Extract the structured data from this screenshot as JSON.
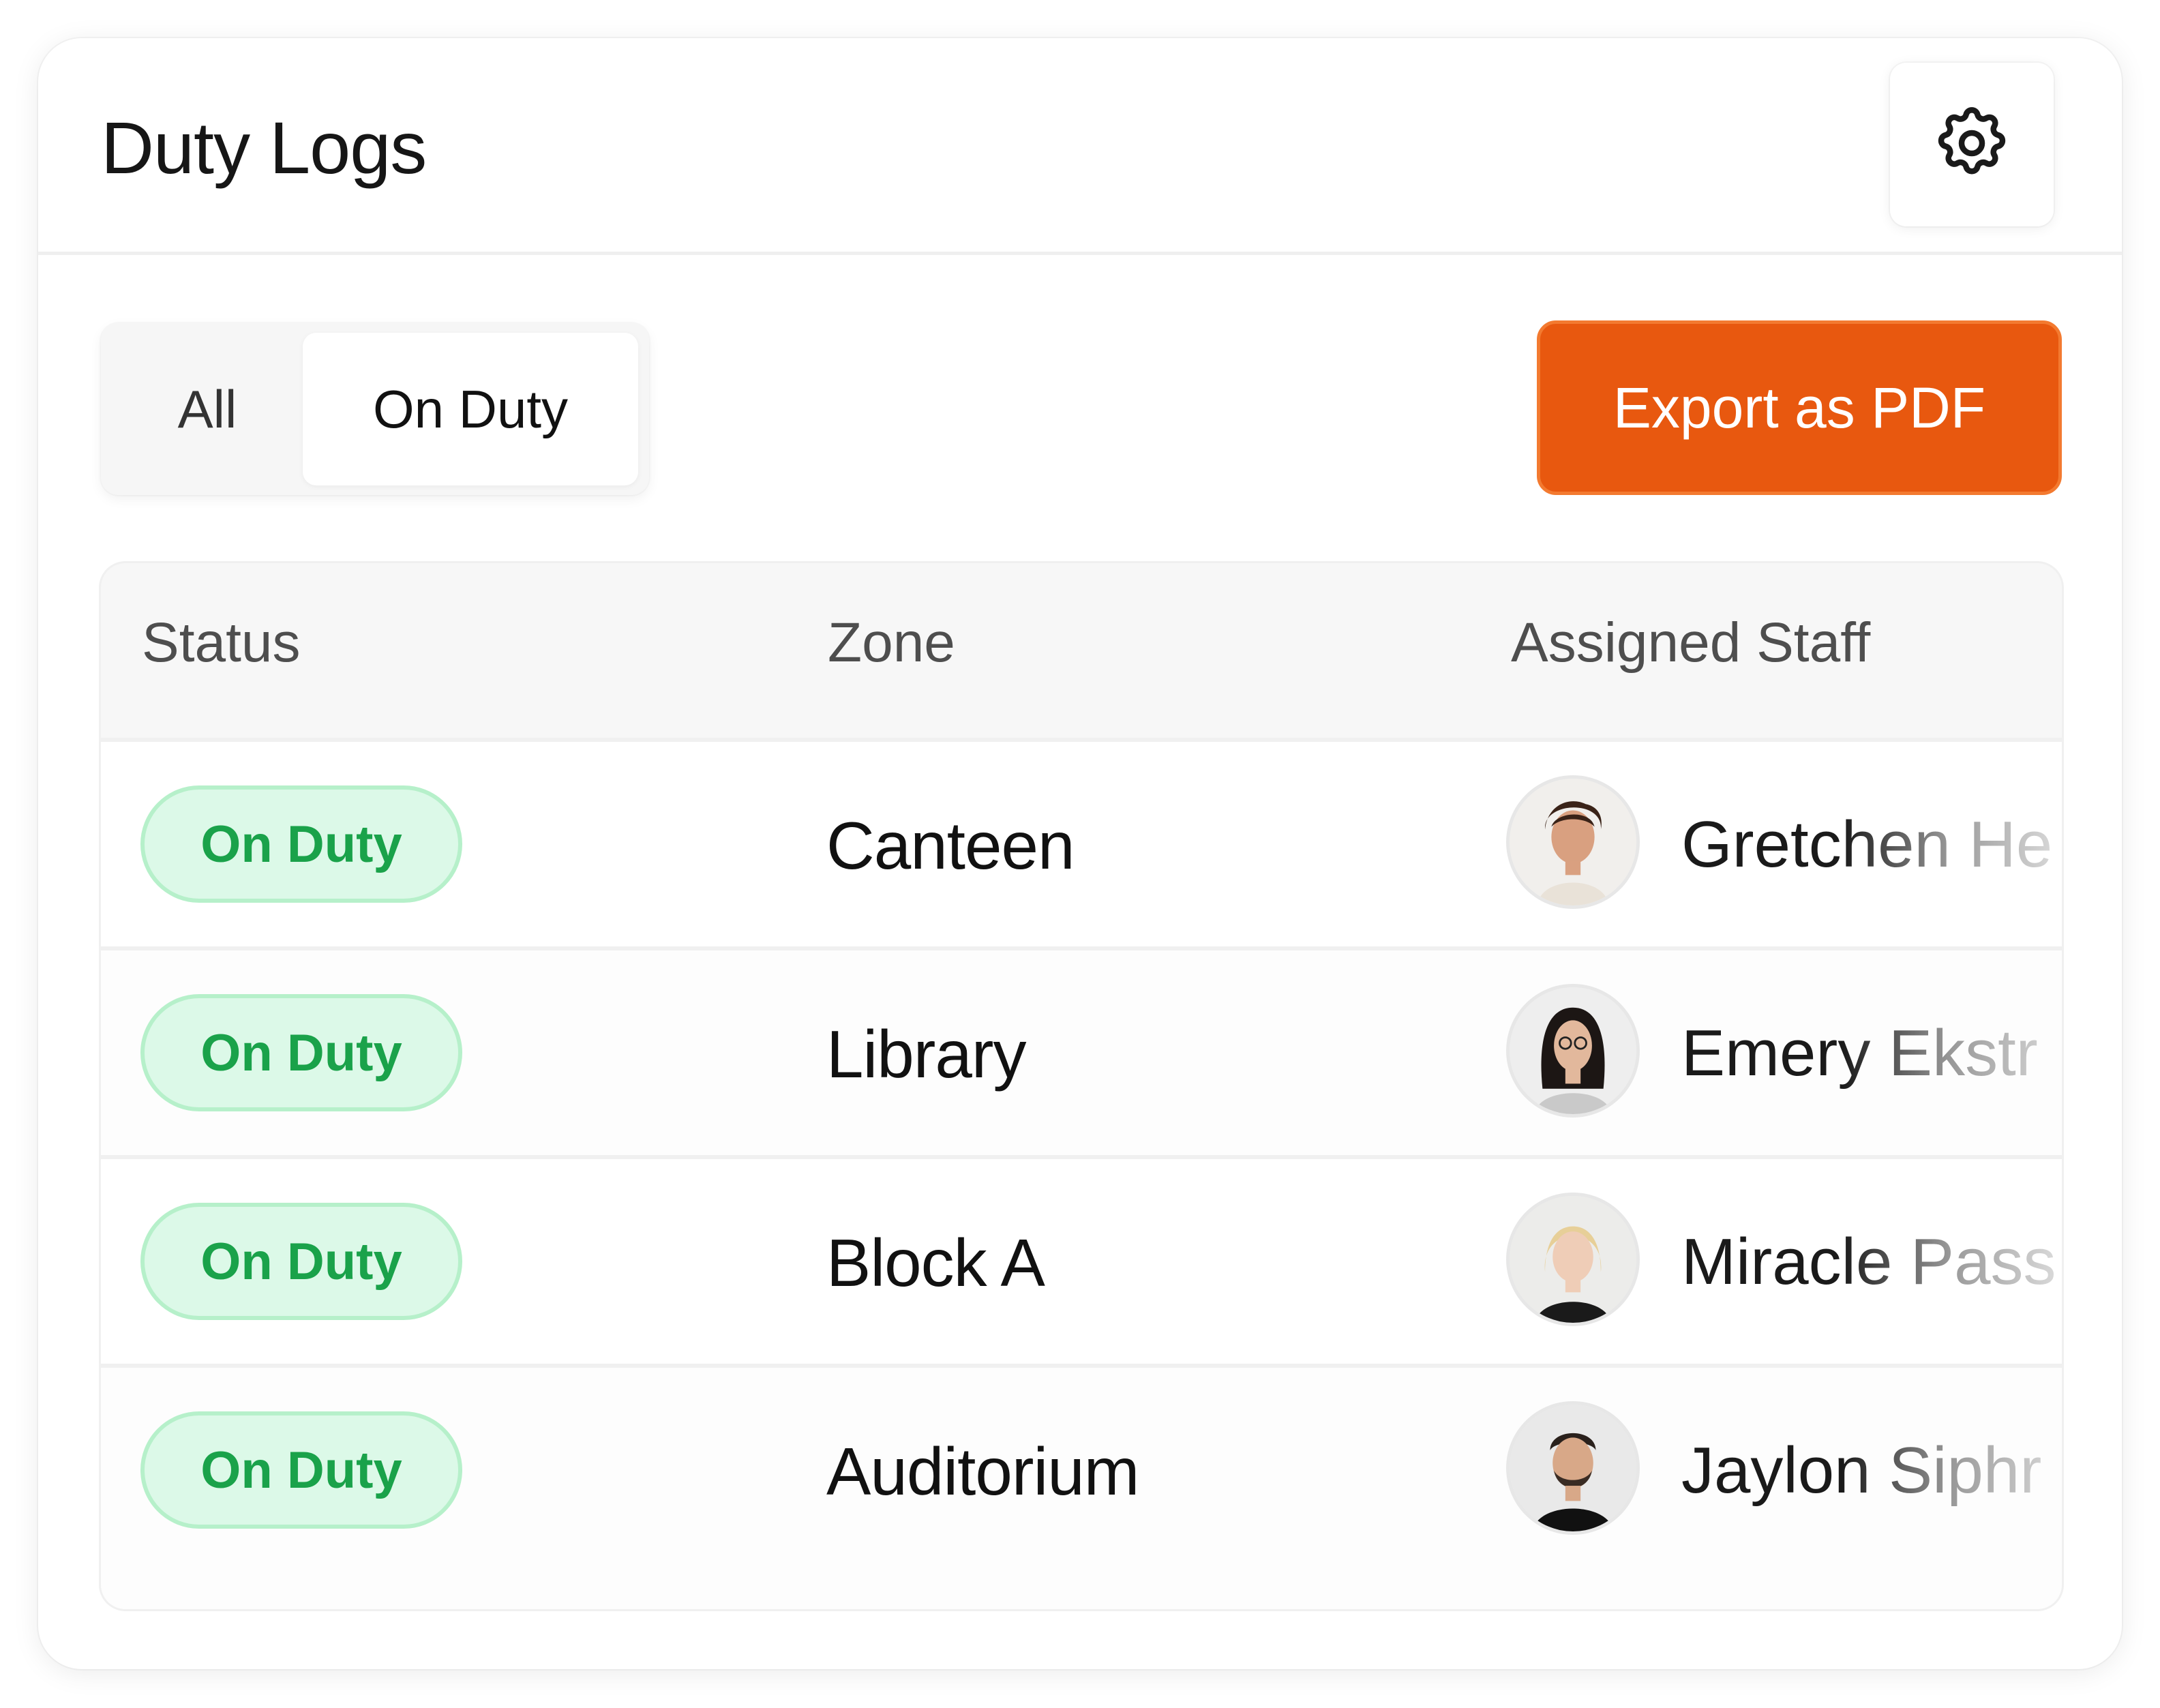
{
  "header": {
    "title": "Duty Logs",
    "settings_icon": "gear-icon"
  },
  "filters": {
    "tabs": [
      {
        "label": "All",
        "active": false
      },
      {
        "label": "On Duty",
        "active": true
      }
    ]
  },
  "toolbar": {
    "export_label": "Export as PDF"
  },
  "colors": {
    "accent": "#E8580F",
    "badge_bg": "#DCF9E8",
    "badge_text": "#1AA24A"
  },
  "table": {
    "columns": [
      "Status",
      "Zone",
      "Assigned Staff"
    ],
    "rows": [
      {
        "status": "On Duty",
        "zone": "Canteen",
        "staff": "Gretchen He"
      },
      {
        "status": "On Duty",
        "zone": "Library",
        "staff": "Emery Ekstr"
      },
      {
        "status": "On Duty",
        "zone": "Block A",
        "staff": "Miracle Pass"
      },
      {
        "status": "On Duty",
        "zone": "Auditorium",
        "staff": "Jaylon Siphr"
      }
    ]
  }
}
